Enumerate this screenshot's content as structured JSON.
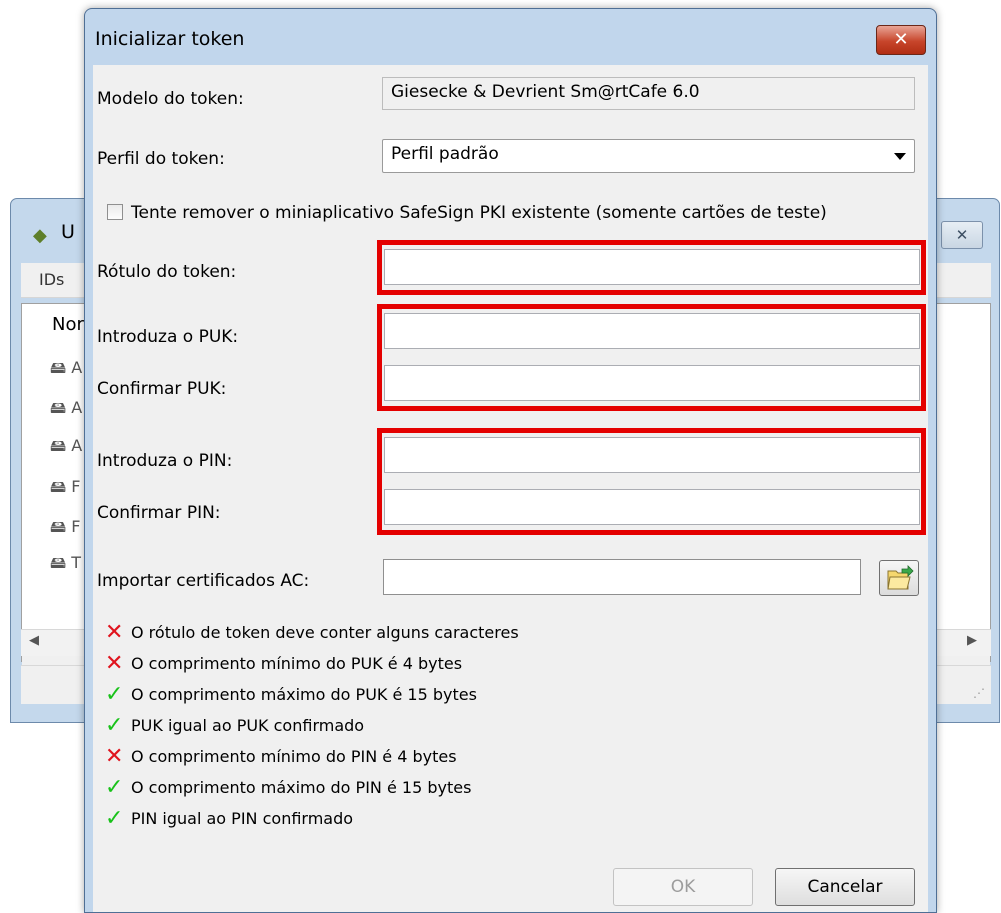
{
  "background_window": {
    "title": "U",
    "menu": "IDs",
    "column_header": "Nor",
    "rows": [
      "A",
      "A",
      "A",
      "F",
      "F",
      "T"
    ],
    "close_symbol": "✕"
  },
  "dialog": {
    "title": "Inicializar token",
    "close_symbol": "✕"
  },
  "form": {
    "model_label": "Modelo do token:",
    "model_value": "Giesecke & Devrient Sm@rtCafe 6.0",
    "profile_label": "Perfil do token:",
    "profile_value": "Perfil padrão",
    "remove_applet_label": "Tente remover o miniaplicativo SafeSign PKI existente (somente cartões de teste)",
    "token_label_label": "Rótulo do token:",
    "puk_label": "Introduza o PUK:",
    "puk_confirm_label": "Confirmar PUK:",
    "pin_label": "Introduza o PIN:",
    "pin_confirm_label": "Confirmar PIN:",
    "import_ca_label": "Importar certificados AC:"
  },
  "validation": [
    {
      "status": "fail",
      "text": "O rótulo de token deve conter alguns caracteres"
    },
    {
      "status": "fail",
      "text": "O comprimento mínimo do PUK é 4 bytes"
    },
    {
      "status": "pass",
      "text": "O comprimento máximo do PUK é 15 bytes"
    },
    {
      "status": "pass",
      "text": "PUK igual ao PUK confirmado"
    },
    {
      "status": "fail",
      "text": "O comprimento mínimo do PIN é 4 bytes"
    },
    {
      "status": "pass",
      "text": "O comprimento máximo do PIN é 15 bytes"
    },
    {
      "status": "pass",
      "text": "PIN igual ao PIN confirmado"
    }
  ],
  "buttons": {
    "ok": "OK",
    "cancel": "Cancelar"
  },
  "icons": {
    "fail": "cross-icon",
    "pass": "checkmark-icon",
    "browse": "folder-open-icon"
  },
  "colors": {
    "highlight": "#e40000",
    "fail": "#e0141e",
    "pass": "#19c21a"
  }
}
